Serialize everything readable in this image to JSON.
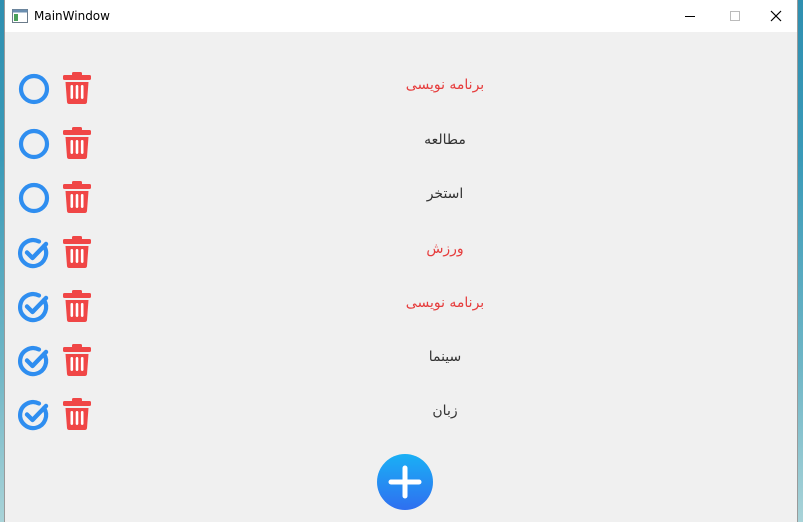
{
  "window": {
    "title": "MainWindow"
  },
  "colors": {
    "accent_blue": "#2f8ef0",
    "delete_red": "#f04646",
    "pending_text": "#e63c3c",
    "normal_text": "#333333"
  },
  "tasks": [
    {
      "label": "برنامه نویسی",
      "status_icon": "circle-outline-icon",
      "completed": false,
      "highlighted": true
    },
    {
      "label": "مطالعه",
      "status_icon": "circle-outline-icon",
      "completed": false,
      "highlighted": false
    },
    {
      "label": "استخر",
      "status_icon": "circle-outline-icon",
      "completed": false,
      "highlighted": false
    },
    {
      "label": "ورزش",
      "status_icon": "check-circle-icon",
      "completed": true,
      "highlighted": true
    },
    {
      "label": "برنامه نویسی",
      "status_icon": "check-circle-icon",
      "completed": true,
      "highlighted": true
    },
    {
      "label": "سینما",
      "status_icon": "check-circle-icon",
      "completed": true,
      "highlighted": false
    },
    {
      "label": "زبان",
      "status_icon": "check-circle-icon",
      "completed": true,
      "highlighted": false
    }
  ],
  "add_button": {
    "icon": "plus-icon"
  }
}
